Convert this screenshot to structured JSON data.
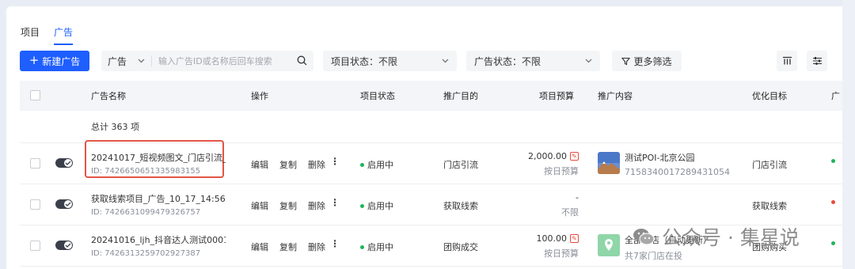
{
  "tabs": [
    {
      "label": "项目",
      "active": false
    },
    {
      "label": "广告",
      "active": true
    }
  ],
  "toolbar": {
    "new_button": "新建广告",
    "search_type": "广告",
    "search_placeholder": "输入广告ID或名称后回车搜索",
    "project_status": "项目状态：不限",
    "ad_status": "广告状态：不限",
    "more_filter": "更多筛选"
  },
  "columns": [
    "广告名称",
    "操作",
    "项目状态",
    "推广目的",
    "项目预算",
    "推广内容",
    "优化目标",
    "广"
  ],
  "total": "总计 363 项",
  "ops": [
    "编辑",
    "复制",
    "删除"
  ],
  "rows": [
    {
      "name": "20241017_短视频图文_门店引流_...",
      "id": "ID: 7426650651335983155",
      "status": "启用中",
      "purpose": "门店引流",
      "budget": "2,000.00",
      "budget_type": "按日预算",
      "promo_title": "测试POI-北京公园",
      "promo_id": "7158340017289431054",
      "optimize": "门店引流",
      "edge_color": "#1fb45a",
      "highlighted": true
    },
    {
      "name": "获取线索项目_广告_10_17_14:56:...",
      "id": "ID: 7426631099479326757",
      "status": "启用中",
      "purpose": "获取线索",
      "budget": "-",
      "budget_type": "不限",
      "promo_title": "",
      "promo_id": "",
      "optimize": "获取线索",
      "edge_color": "#e84a3b",
      "highlighted": false
    },
    {
      "name": "20241016_ljh_抖音达人测试0001...",
      "id": "ID: 7426313259702927387",
      "status": "启用中",
      "purpose": "团购成交",
      "budget": "100.00",
      "budget_type": "按日预算",
      "promo_title": "全部门店（自动更新）",
      "promo_id": "共7家门店在投",
      "optimize": "团购购买",
      "edge_color": "#1fb45a",
      "highlighted": false
    }
  ],
  "watermark": {
    "text": "公众号 · 集星说"
  },
  "colors": {
    "primary": "#1f5eff",
    "success": "#1fb45a",
    "danger": "#e84a3b"
  }
}
